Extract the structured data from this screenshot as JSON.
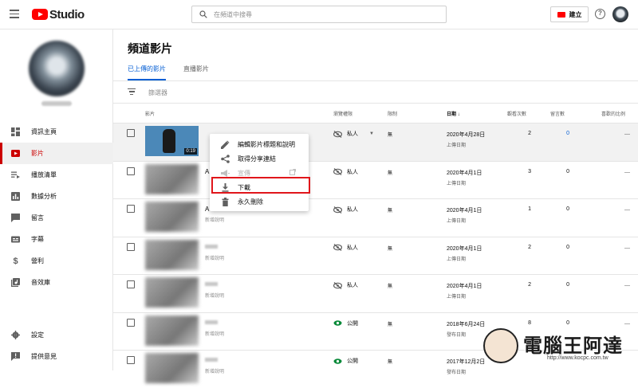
{
  "app": {
    "brand": "Studio",
    "create_label": "建立",
    "help": "?"
  },
  "search": {
    "placeholder": "在頻道中搜尋"
  },
  "sidebar": {
    "items": [
      {
        "label": "資訊主頁",
        "icon": "dashboard-icon"
      },
      {
        "label": "影片",
        "icon": "video-icon",
        "active": true
      },
      {
        "label": "播放清單",
        "icon": "playlist-icon"
      },
      {
        "label": "數據分析",
        "icon": "analytics-icon"
      },
      {
        "label": "留言",
        "icon": "comment-icon"
      },
      {
        "label": "字幕",
        "icon": "subtitle-icon"
      },
      {
        "label": "營利",
        "icon": "dollar-icon"
      },
      {
        "label": "音效庫",
        "icon": "audio-library-icon"
      }
    ],
    "bottom": [
      {
        "label": "設定",
        "icon": "gear-icon"
      },
      {
        "label": "提供意見",
        "icon": "feedback-icon"
      }
    ]
  },
  "main": {
    "title": "頻道影片",
    "tabs": [
      {
        "label": "已上傳的影片",
        "active": true
      },
      {
        "label": "直播影片"
      }
    ],
    "filter_label": "篩選器",
    "columns": {
      "video": "影片",
      "visibility": "瀏覽權限",
      "restriction": "限制",
      "date": "日期",
      "views": "觀看次數",
      "comments": "留言數",
      "likes": "喜歡的比例"
    },
    "rows": [
      {
        "title": "",
        "desc": "",
        "duration": "0:19",
        "visibility": "私人",
        "restriction": "無",
        "date": "2020年4月28日",
        "date_sub": "上傳日期",
        "views": "2",
        "comments": "0",
        "likes": "—"
      },
      {
        "title": "A",
        "desc": "",
        "visibility": "私人",
        "restriction": "無",
        "date": "2020年4月1日",
        "date_sub": "上傳日期",
        "views": "3",
        "comments": "0",
        "likes": "—"
      },
      {
        "title": "A",
        "desc": "新增說明",
        "visibility": "私人",
        "restriction": "無",
        "date": "2020年4月1日",
        "date_sub": "上傳日期",
        "views": "1",
        "comments": "0",
        "likes": "—"
      },
      {
        "title": "",
        "desc": "新增說明",
        "visibility": "私人",
        "restriction": "無",
        "date": "2020年4月1日",
        "date_sub": "上傳日期",
        "views": "2",
        "comments": "0",
        "likes": "—"
      },
      {
        "title": "",
        "desc": "新增說明",
        "visibility": "私人",
        "restriction": "無",
        "date": "2020年4月1日",
        "date_sub": "上傳日期",
        "views": "2",
        "comments": "0",
        "likes": "—"
      },
      {
        "title": "",
        "desc": "新增說明",
        "visibility": "公開",
        "restriction": "無",
        "date": "2018年6月24日",
        "date_sub": "發布日期",
        "views": "8",
        "comments": "0",
        "likes": "—"
      },
      {
        "title": "",
        "desc": "新增說明",
        "visibility": "公開",
        "restriction": "無",
        "date": "2017年12月2日",
        "date_sub": "發布日期",
        "views": "",
        "comments": "",
        "likes": ""
      }
    ]
  },
  "context_menu": {
    "items": [
      {
        "label": "編輯影片標題和說明",
        "icon": "pencil-icon"
      },
      {
        "label": "取得分享連結",
        "icon": "share-icon"
      },
      {
        "label": "宣傳",
        "icon": "megaphone-icon",
        "disabled": true
      },
      {
        "label": "下載",
        "icon": "download-icon"
      },
      {
        "label": "永久刪除",
        "icon": "trash-icon"
      }
    ]
  },
  "watermark": {
    "text": "電腦王阿達",
    "url": "http://www.kocpc.com.tw"
  },
  "colors": {
    "brand_red": "#ff0000",
    "link_blue": "#065fd4",
    "active_red": "#cc0000",
    "public_green": "#0a8a3a",
    "highlight_red": "#e0161b"
  }
}
